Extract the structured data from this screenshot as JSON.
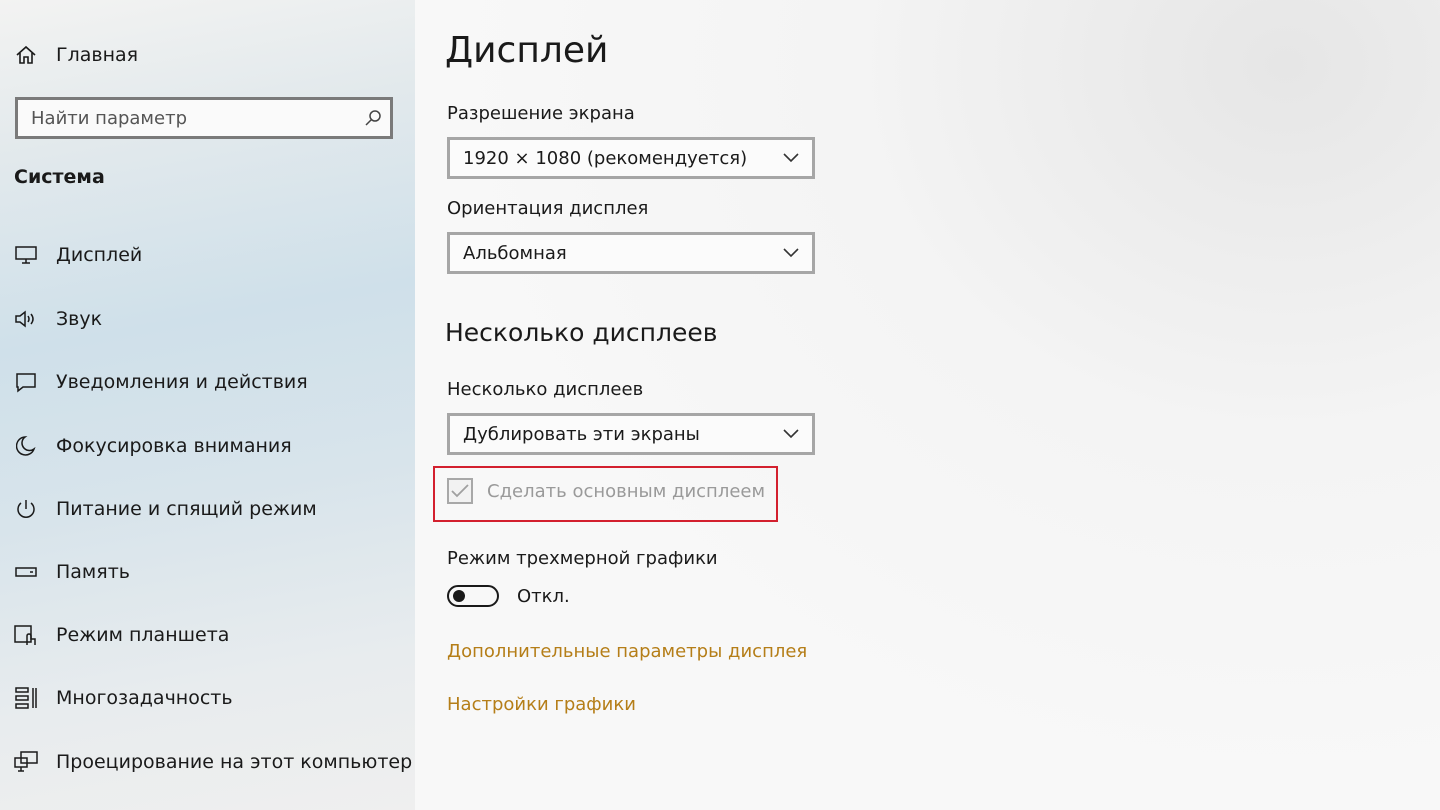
{
  "sidebar": {
    "home_label": "Главная",
    "search_placeholder": "Найти параметр",
    "section_title": "Система",
    "items": [
      {
        "label": "Дисплей",
        "icon": "monitor-icon"
      },
      {
        "label": "Звук",
        "icon": "speaker-icon"
      },
      {
        "label": "Уведомления и действия",
        "icon": "notification-icon"
      },
      {
        "label": "Фокусировка внимания",
        "icon": "moon-icon"
      },
      {
        "label": "Питание и спящий режим",
        "icon": "power-icon"
      },
      {
        "label": "Память",
        "icon": "storage-icon"
      },
      {
        "label": "Режим планшета",
        "icon": "tablet-icon"
      },
      {
        "label": "Многозадачность",
        "icon": "multitasking-icon"
      },
      {
        "label": "Проецирование на этот компьютер",
        "icon": "projecting-icon"
      }
    ]
  },
  "main": {
    "title": "Дисплей",
    "resolution": {
      "label": "Разрешение экрана",
      "value": "1920 × 1080 (рекомендуется)"
    },
    "orientation": {
      "label": "Ориентация дисплея",
      "value": "Альбомная"
    },
    "multi_section_title": "Несколько дисплеев",
    "multi": {
      "label": "Несколько дисплеев",
      "value": "Дублировать эти экраны"
    },
    "make_main": {
      "label": "Сделать основным дисплеем",
      "checked": true,
      "disabled": true
    },
    "hdr": {
      "label": "Режим трехмерной графики",
      "state_label": "Откл.",
      "on": false
    },
    "links": {
      "advanced": "Дополнительные параметры дисплея",
      "graphics": "Настройки графики"
    }
  },
  "colors": {
    "accent_link": "#b57e18",
    "highlight": "#d3202e"
  }
}
